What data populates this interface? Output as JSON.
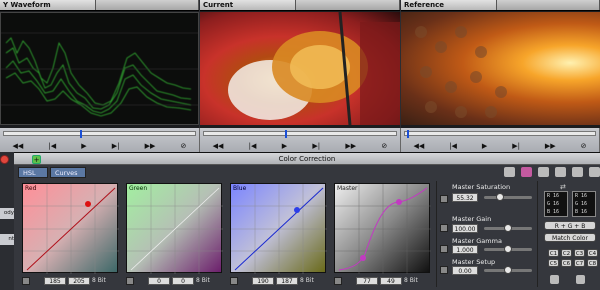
{
  "panes": [
    {
      "title": "Y Waveform",
      "chevron": "▾"
    },
    {
      "title": "Current",
      "chevron": "▾"
    },
    {
      "title": "Reference",
      "chevron": "▾"
    }
  ],
  "transport": {
    "back": "◀◀",
    "step_back": "|◀",
    "play": "▶",
    "step_fwd": "▶|",
    "fwd": "▶▶",
    "stop": "⊘"
  },
  "panel": {
    "title": "Color Correction",
    "tabs": [
      "HSL",
      "Curves"
    ],
    "curves": [
      {
        "label": "Red",
        "v1": "185",
        "v2": "205",
        "bit": "8 Bit"
      },
      {
        "label": "Green",
        "v1": "0",
        "v2": "0",
        "bit": "8 Bit"
      },
      {
        "label": "Blue",
        "v1": "190",
        "v2": "187",
        "bit": "8 Bit"
      },
      {
        "label": "Master",
        "v1": "77",
        "v2": "49",
        "bit": "8 Bit"
      }
    ],
    "master": [
      {
        "label": "Master Saturation",
        "value": "55.32"
      },
      {
        "label": "Master Gain",
        "value": "100.00"
      },
      {
        "label": "Master Gamma",
        "value": "1.000"
      },
      {
        "label": "Master Setup",
        "value": "0.00"
      }
    ],
    "swatches": [
      [
        "R",
        "16",
        "G",
        "16",
        "B",
        "16"
      ],
      [
        "R",
        "16",
        "G",
        "16",
        "B",
        "16"
      ]
    ],
    "rgb_select": "R + G + B",
    "match_color": "Match Color",
    "c_buttons": [
      "C1",
      "C2",
      "C3",
      "C4",
      "C5",
      "C6",
      "C7",
      "C8"
    ],
    "left_edge": [
      "ody",
      "nt"
    ]
  }
}
